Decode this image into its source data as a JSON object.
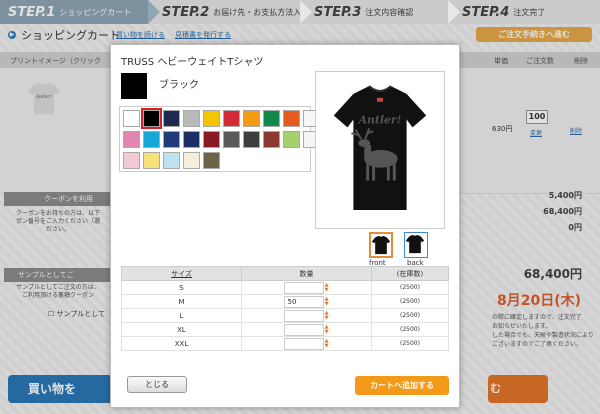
{
  "steps": [
    {
      "num": "STEP.1",
      "label": "ショッピングカート"
    },
    {
      "num": "STEP.2",
      "label": "お届け先・お支払方法入力"
    },
    {
      "num": "STEP.3",
      "label": "注文内容確認"
    },
    {
      "num": "STEP.4",
      "label": "注文完了"
    }
  ],
  "cart": {
    "title": "ショッピングカート",
    "links": [
      "買い物を続ける",
      "見積書を発行する"
    ],
    "checkout_label": "ご注文手続きへ進む"
  },
  "table_head": {
    "image_col": "プリントイメージ（クリック",
    "price_col": "単価",
    "qty_col": "ご注文数",
    "delete_col": "削除"
  },
  "row": {
    "price": "630円",
    "qty": "100",
    "change": "変更",
    "delete": "削除",
    "shirt_text": "Antler!"
  },
  "coupon": {
    "head": "クーポンを利用",
    "text": "クーポンをお持ちの方は、以下\nポン番号をご入力ください（選\nださい。"
  },
  "sample": {
    "head": "サンプルとしてご",
    "text": "サンプルとしてご注文の方は、\nご利用頂ける裏額クーポン",
    "checkbox_label": "サンプルとして"
  },
  "summary": {
    "subtotal": "5,400円",
    "total1": "68,400円",
    "discount": "0円",
    "total_big": "68,400円",
    "date": "8月20日(木)",
    "note": "の際に確定しますので、注文完了\nお知らせいたします。\nした場合でも、天候や製造状況により\nございますのでご了承ください。"
  },
  "bottom": {
    "shop_button": "買い物を",
    "orange_button": "む"
  },
  "modal": {
    "product_name": "TRUSS ヘビーウェイトTシャツ",
    "color_name": "ブラック",
    "selected_color": "#000000",
    "colors": [
      "#ffffff",
      "#000000",
      "#1e2a4d",
      "#b9b9b9",
      "#f5c400",
      "#d32a35",
      "#f39c12",
      "#12884a",
      "#e35c1d",
      "#f7f7f7",
      "#e385b3",
      "#14a9d9",
      "#203a7a",
      "#1d2e66",
      "#8a1a26",
      "#5a5a5a",
      "#3e3e3e",
      "#8a3a2e",
      "#a5cf71",
      "#f4f4f4",
      "#f4c8d6",
      "#f7e27a",
      "#bfe3ee",
      "#f4efd9",
      "#6b6449"
    ],
    "thumb_front": "front",
    "thumb_back": "back",
    "size_table": {
      "headers": [
        "サイズ",
        "数量",
        "(在庫数)"
      ],
      "rows": [
        {
          "size": "S",
          "qty": "",
          "stock": "(2500)"
        },
        {
          "size": "M",
          "qty": "50",
          "stock": "(2500)"
        },
        {
          "size": "L",
          "qty": "",
          "stock": "(2500)"
        },
        {
          "size": "XL",
          "qty": "",
          "stock": "(2500)"
        },
        {
          "size": "XXL",
          "qty": "",
          "stock": "(2500)"
        }
      ]
    },
    "close_label": "とじる",
    "add_label": "カートへ追加する"
  }
}
